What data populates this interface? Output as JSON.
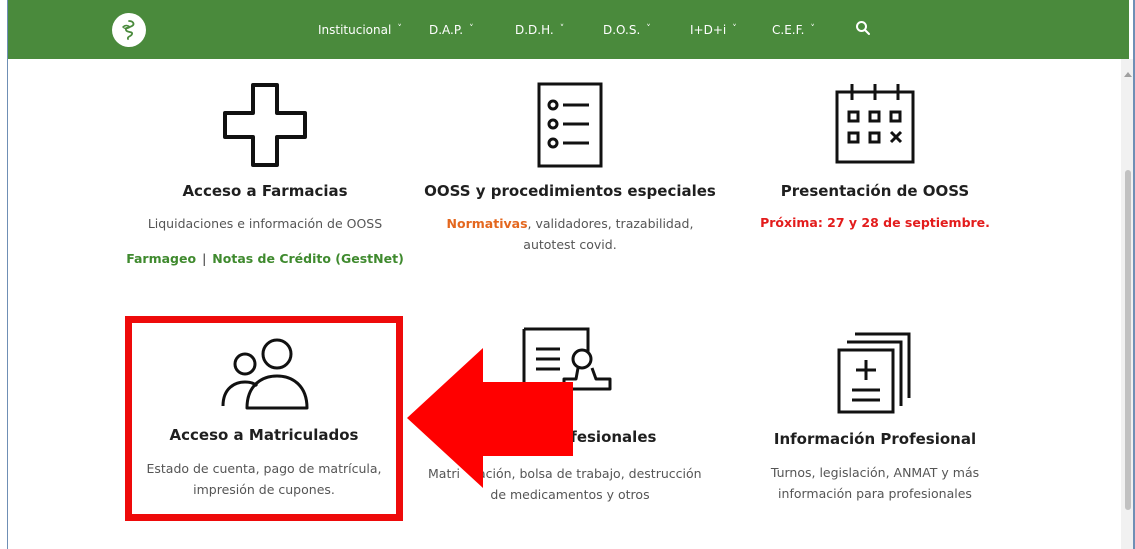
{
  "nav": {
    "items": [
      {
        "label": "Institucional"
      },
      {
        "label": "D.A.P."
      },
      {
        "label": "D.D.H."
      },
      {
        "label": "D.O.S."
      },
      {
        "label": "I+D+i"
      },
      {
        "label": "C.E.F."
      }
    ],
    "search_icon": "search-icon",
    "chevron": "˅"
  },
  "cards": {
    "farmacias": {
      "title": "Acceso a Farmacias",
      "desc": "Liquidaciones e información de OOSS",
      "link1": "Farmageo",
      "sep": "|",
      "link2": "Notas de Crédito (GestNet)",
      "icon": "plus-cross-icon"
    },
    "ooss": {
      "title": "OOSS y procedimientos especiales",
      "highlight": "Normativas",
      "desc_rest": ", validadores, trazabilidad,",
      "desc_line2": "autotest covid.",
      "icon": "checklist-icon"
    },
    "presentacion": {
      "title": "Presentación de OOSS",
      "notice": "Próxima: 27 y 28 de septiembre.",
      "icon": "calendar-icon"
    },
    "matriculados": {
      "title": "Acceso a Matriculados",
      "desc_line1": "Estado de cuenta, pago de matrícula,",
      "desc_line2": "impresión de cupones.",
      "icon": "users-icon"
    },
    "profesionales": {
      "title_visible": "ofesionales",
      "desc_line1_a": "Matri",
      "desc_line1_b": "ación, bolsa de trabajo, destrucción",
      "desc_line2": "de medicamentos y otros",
      "icon": "document-stamp-icon"
    },
    "info_profesional": {
      "title": "Información Profesional",
      "desc_line1": "Turnos, legislación, ANMAT y más",
      "desc_line2": "información para profesionales",
      "icon": "document-plus-icon"
    }
  },
  "annotation": {
    "box_color": "#ee0a0a",
    "arrow_color": "#ff0000"
  },
  "colors": {
    "nav_bg": "#4a8a3c",
    "link_green": "#3f8a2e",
    "orange": "#e4671e",
    "red": "#e31c1c"
  }
}
